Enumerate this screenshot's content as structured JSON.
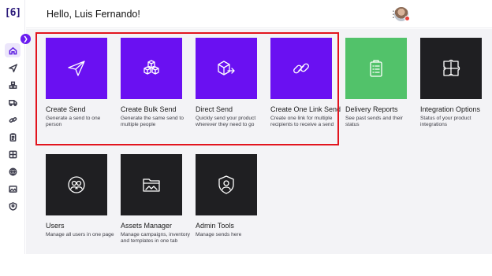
{
  "app": {
    "logo_text": "[6]"
  },
  "header": {
    "greeting": "Hello, Luis Fernando!",
    "menu_icon": "kebab-icon",
    "avatar": "user-avatar"
  },
  "sidebar": {
    "collapse_icon": "chevron-right-icon",
    "items": [
      {
        "icon": "home-icon",
        "active": true
      },
      {
        "icon": "send-icon"
      },
      {
        "icon": "boxes-icon"
      },
      {
        "icon": "truck-icon"
      },
      {
        "icon": "link-icon"
      },
      {
        "icon": "clipboard-icon"
      },
      {
        "icon": "puzzle-icon"
      },
      {
        "icon": "globe-icon"
      },
      {
        "icon": "image-icon"
      },
      {
        "icon": "shield-icon"
      }
    ]
  },
  "cards": [
    {
      "title": "Create Send",
      "desc": "Generate a send to one person",
      "color": "#6a10f2",
      "icon": "paper-plane-icon"
    },
    {
      "title": "Create Bulk Send",
      "desc": "Generate the same send to multiple people",
      "color": "#6a10f2",
      "icon": "boxes-icon"
    },
    {
      "title": "Direct Send",
      "desc": "Quickly send your product wherever they need to go",
      "color": "#6a10f2",
      "icon": "box-arrow-icon"
    },
    {
      "title": "Create One Link Send",
      "desc": "Create one link for multiple recipients to receive a send",
      "color": "#6a10f2",
      "icon": "link-icon"
    },
    {
      "title": "Delivery Reports",
      "desc": "See past sends and their status",
      "color": "#52c26a",
      "icon": "clipboard-icon"
    },
    {
      "title": "Integration Options",
      "desc": "Status of your product integrations",
      "color": "#1f1f22",
      "icon": "puzzle-icon"
    },
    {
      "title": "Users",
      "desc": "Manage all users in one page",
      "color": "#1f1f22",
      "icon": "users-icon"
    },
    {
      "title": "Assets Manager",
      "desc": "Manage campaigns, inventory and templates in one tab",
      "color": "#1f1f22",
      "icon": "folder-icon"
    },
    {
      "title": "Admin Tools",
      "desc": "Manage sends here",
      "color": "#1f1f22",
      "icon": "shield-user-icon"
    }
  ],
  "highlight_color": "#e2141e"
}
